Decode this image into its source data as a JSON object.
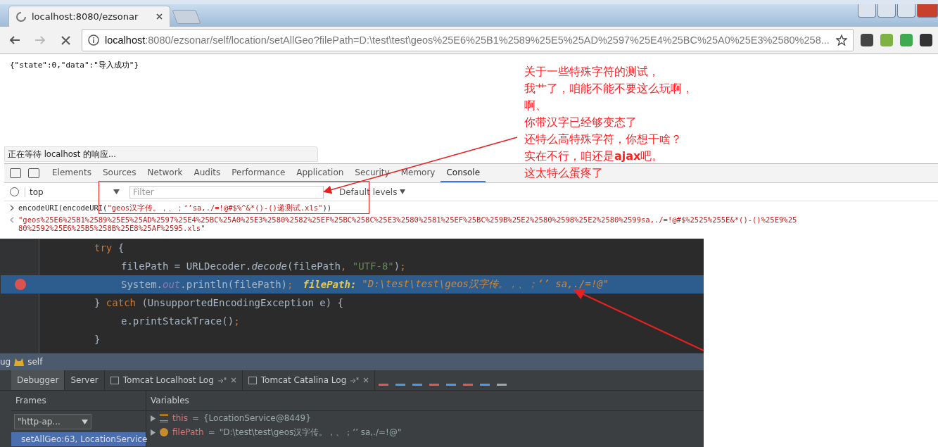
{
  "browser": {
    "tab_title": "localhost:8080/ezsonar",
    "address_host": "localhost",
    "address_path": ":8080/ezsonar/self/location/setAllGeo?filePath=D:\\test\\test\\geos%25E6%25B1%2589%25E5%25AD%2597%25E4%25BC%25A0%25E3%2580%258..."
  },
  "page_text": "{\"state\":0,\"data\":\"导入成功\"}",
  "annotation": [
    "关于一些特殊字符的测试，",
    "我艹了，咱能不能不要这么玩啊，",
    "啊、",
    "你带汉字已经够变态了",
    "还特么高特殊字符，你想干啥？",
    "实在不行，咱还是**ajax**吧。",
    "这太特么蛋疼了"
  ],
  "status": "正在等待 localhost 的响应...",
  "devtools": {
    "tabs": [
      {
        "label": "Elements",
        "selected": false
      },
      {
        "label": "Sources",
        "selected": false
      },
      {
        "label": "Network",
        "selected": false
      },
      {
        "label": "Audits",
        "selected": false
      },
      {
        "label": "Performance",
        "selected": false
      },
      {
        "label": "Application",
        "selected": false
      },
      {
        "label": "Security",
        "selected": false
      },
      {
        "label": "Memory",
        "selected": false
      },
      {
        "label": "Console",
        "selected": true
      }
    ],
    "context": "top",
    "filter_placeholder": "Filter",
    "levels": "Default levels",
    "input": {
      "prefix": "encodeURI(encodeURI(",
      "string": "\"geos汉字传。，、；‘’sa,./=!@#$%^&*()-()递测试.xls\"",
      "suffix": "))"
    },
    "output": "\"geos%25E6%25B1%2589%25E5%25AD%2597%25E4%25BC%25A0%25E3%2580%2582%25EF%25BC%258C%25E3%2580%2581%25EF%25BC%259B%25E2%2580%2598%25E2%2580%2599sa,./=!@#$%2525%255E&*()-()%25E9%2580%2592%25E6%25B5%258B%25E8%25AF%2595.xls\""
  },
  "code": [
    {
      "current": false,
      "tokens": [
        {
          "kind": "keyword",
          "text": "try"
        },
        {
          "kind": "plain",
          "text": " {"
        }
      ],
      "children": [
        {
          "current": false,
          "tokens": [
            {
              "kind": "plain",
              "text": "filePath = URLDecoder."
            },
            {
              "kind": "method",
              "text": "decode"
            },
            {
              "kind": "plain",
              "text": "(filePath"
            },
            {
              "kind": "keyword",
              "text": ", "
            },
            {
              "kind": "string",
              "text": "\"UTF-8\""
            },
            {
              "kind": "plain",
              "text": ")"
            },
            {
              "kind": "keyword",
              "text": ";"
            }
          ]
        },
        {
          "current": true,
          "tokens": [
            {
              "kind": "plain",
              "text": "System."
            },
            {
              "kind": "field",
              "text": "out"
            },
            {
              "kind": "plain",
              "text": ".println(filePath)"
            },
            {
              "kind": "keyword",
              "text": ";"
            },
            {
              "kind": "inline_name",
              "text": "filePath:"
            },
            {
              "kind": "inline_value",
              "text": "\"D:\\test\\test\\geos汉字传。，、；‘’ sa,./=!@\""
            }
          ]
        }
      ]
    },
    {
      "current": false,
      "tokens": [
        {
          "kind": "plain",
          "text": "} "
        },
        {
          "kind": "keyword",
          "text": "catch"
        },
        {
          "kind": "plain",
          "text": " (UnsupportedEncodingException e) {"
        }
      ],
      "children": [
        {
          "current": false,
          "tokens": [
            {
              "kind": "plain",
              "text": "e.printStackTrace()"
            },
            {
              "kind": "keyword",
              "text": ";"
            }
          ]
        }
      ]
    },
    {
      "current": false,
      "tokens": [
        {
          "kind": "plain",
          "text": "}"
        }
      ]
    }
  ],
  "debug": {
    "title": "ug",
    "config": "self",
    "tabs": [
      {
        "label": "Debugger",
        "selected": true,
        "kind": "plain"
      },
      {
        "label": "Server",
        "selected": false,
        "kind": "plain"
      },
      {
        "label": "Tomcat Localhost Log",
        "selected": false,
        "kind": "log"
      },
      {
        "label": "Tomcat Catalina Log",
        "selected": false,
        "kind": "log"
      }
    ],
    "frames_title": "Frames",
    "thread": "\"http-ap...",
    "frames": [
      {
        "label": "setAllGeo:63, LocationService",
        "selected": true
      }
    ],
    "variables_title": "Variables",
    "variables": [
      {
        "kind": "object",
        "name": "this",
        "operator": "=",
        "value": "{LocationService@8449}"
      },
      {
        "kind": "param",
        "name": "filePath",
        "operator": "=",
        "value": "\"D:\\test\\test\\geos汉字传。，、；‘’ sa,./=!@\""
      }
    ]
  }
}
